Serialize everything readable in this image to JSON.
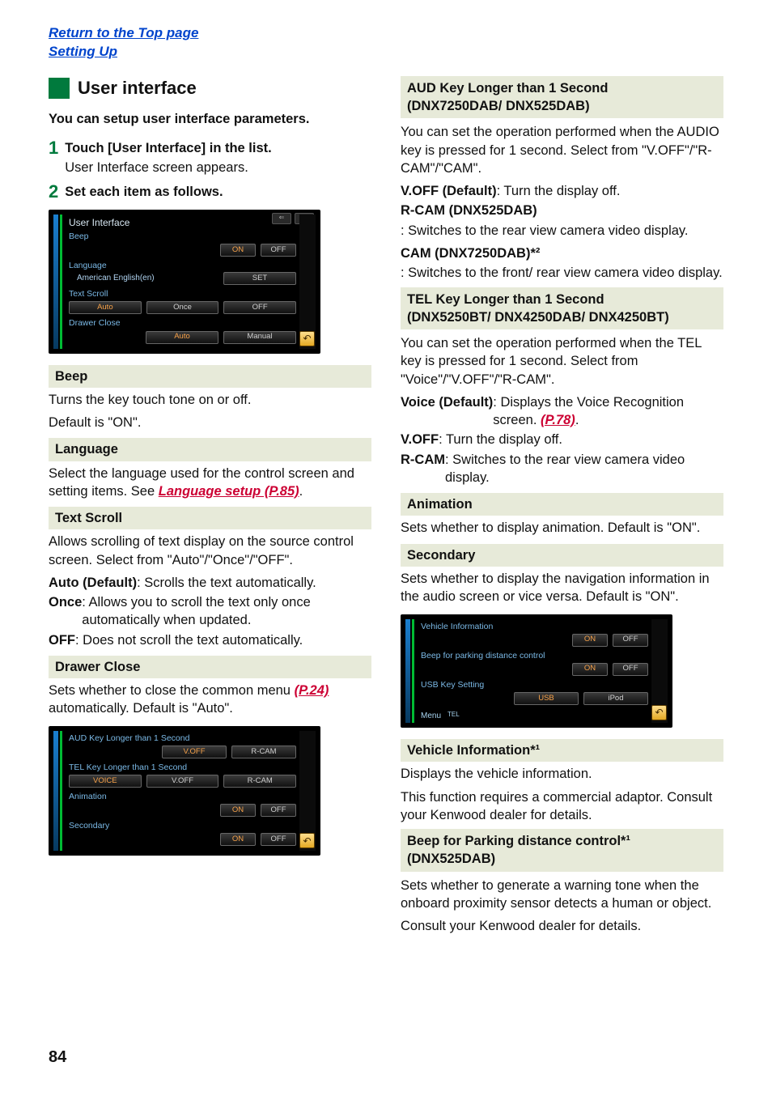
{
  "top_links": {
    "return": "Return to the Top page",
    "section": "Setting Up"
  },
  "left": {
    "heading": "User interface",
    "intro": "You can setup user interface parameters.",
    "steps": [
      {
        "num": "1",
        "title": "Touch [User Interface] in the list.",
        "sub": "User Interface screen appears."
      },
      {
        "num": "2",
        "title": "Set each item as follows.",
        "sub": ""
      }
    ],
    "shot1": {
      "title": "User Interface",
      "rows": {
        "beep": {
          "label": "Beep",
          "on": "ON",
          "off": "OFF"
        },
        "language": {
          "label": "Language",
          "value": "American English(en)",
          "set": "SET"
        },
        "text_scroll": {
          "label": "Text Scroll",
          "auto": "Auto",
          "once": "Once",
          "off": "OFF"
        },
        "drawer_close": {
          "label": "Drawer Close",
          "auto": "Auto",
          "manual": "Manual"
        }
      }
    },
    "beep": {
      "label": "Beep",
      "text1": "Turns the key touch tone on or off.",
      "text2": "Default is \"ON\"."
    },
    "language": {
      "label": "Language",
      "text1": "Select the language used for the control screen and setting items. See ",
      "link": "Language setup (P.85)",
      "after": "."
    },
    "text_scroll": {
      "label": "Text Scroll",
      "text1": "Allows scrolling of text display on the source control screen. Select from \"Auto\"/\"Once\"/\"OFF\".",
      "auto_k": "Auto (Default)",
      "auto_v": ": Scrolls the text automatically.",
      "once_k": "Once",
      "once_v": ": Allows you to scroll the text only once automatically when updated.",
      "off_k": "OFF",
      "off_v": ": Does not scroll the text automatically."
    },
    "drawer_close": {
      "label": "Drawer Close",
      "text1a": "Sets whether to close the common menu ",
      "link": "(P.24)",
      "text1b": " automatically. Default is \"Auto\"."
    },
    "shot2": {
      "rows": {
        "aud": {
          "label": "AUD Key Longer than 1 Second",
          "voff": "V.OFF",
          "rcam": "R-CAM"
        },
        "tel": {
          "label": "TEL Key Longer than 1 Second",
          "voice": "VOICE",
          "voff": "V.OFF",
          "rcam": "R-CAM"
        },
        "animation": {
          "label": "Animation",
          "on": "ON",
          "off": "OFF"
        },
        "secondary": {
          "label": "Secondary",
          "on": "ON",
          "off": "OFF"
        }
      }
    }
  },
  "right": {
    "aud": {
      "title1": "AUD Key Longer than 1 Second",
      "title2": "(DNX7250DAB/ DNX525DAB)",
      "text1": "You can set the operation performed when the AUDIO key is pressed for 1 second. Select from \"V.OFF\"/\"R-CAM\"/\"CAM\".",
      "voff_k": "V.OFF (Default)",
      "voff_v": ": Turn the display off.",
      "rcam_k": "R-CAM (DNX525DAB)",
      "rcam_v": ": Switches to the rear view camera video display.",
      "cam_k": "CAM (DNX7250DAB)*²",
      "cam_v": ": Switches to the front/ rear view camera video display."
    },
    "tel": {
      "title1": "TEL Key Longer than 1 Second",
      "title2": "(DNX5250BT/ DNX4250DAB/ DNX4250BT)",
      "text1": "You can set the operation performed when the TEL key is pressed for 1 second. Select from \"Voice\"/\"V.OFF\"/\"R-CAM\".",
      "voice_k": "Voice (Default)",
      "voice_v": ": Displays the Voice Recognition screen. ",
      "voice_link": "(P.78)",
      "voice_after": ".",
      "voff_k": "V.OFF",
      "voff_v": ": Turn the display off.",
      "rcam_k": "R-CAM",
      "rcam_v": ": Switches to the rear view camera video display."
    },
    "animation": {
      "label": "Animation",
      "text": "Sets whether to display animation. Default is \"ON\"."
    },
    "secondary": {
      "label": "Secondary",
      "text": "Sets whether to display the navigation information in the audio screen or vice versa. Default is \"ON\"."
    },
    "shot3": {
      "rows": {
        "vi": {
          "label": "Vehicle Information",
          "on": "ON",
          "off": "OFF"
        },
        "beep_park": {
          "label": "Beep for parking distance control",
          "on": "ON",
          "off": "OFF"
        },
        "usb": {
          "label": "USB Key Setting",
          "usb": "USB",
          "ipod": "iPod"
        }
      },
      "menu": "Menu",
      "tel": "TEL"
    },
    "vehicle_info": {
      "label": "Vehicle Information*¹",
      "text1": "Displays the vehicle information.",
      "text2": "This function requires a commercial adaptor. Consult your Kenwood dealer for details."
    },
    "beep_park": {
      "label1": "Beep for Parking distance control*¹",
      "label2": "(DNX525DAB)",
      "text1": "Sets whether to generate a warning tone when the onboard proximity sensor detects a human or object.",
      "text2": "Consult your Kenwood dealer for details."
    }
  },
  "page_number": "84"
}
